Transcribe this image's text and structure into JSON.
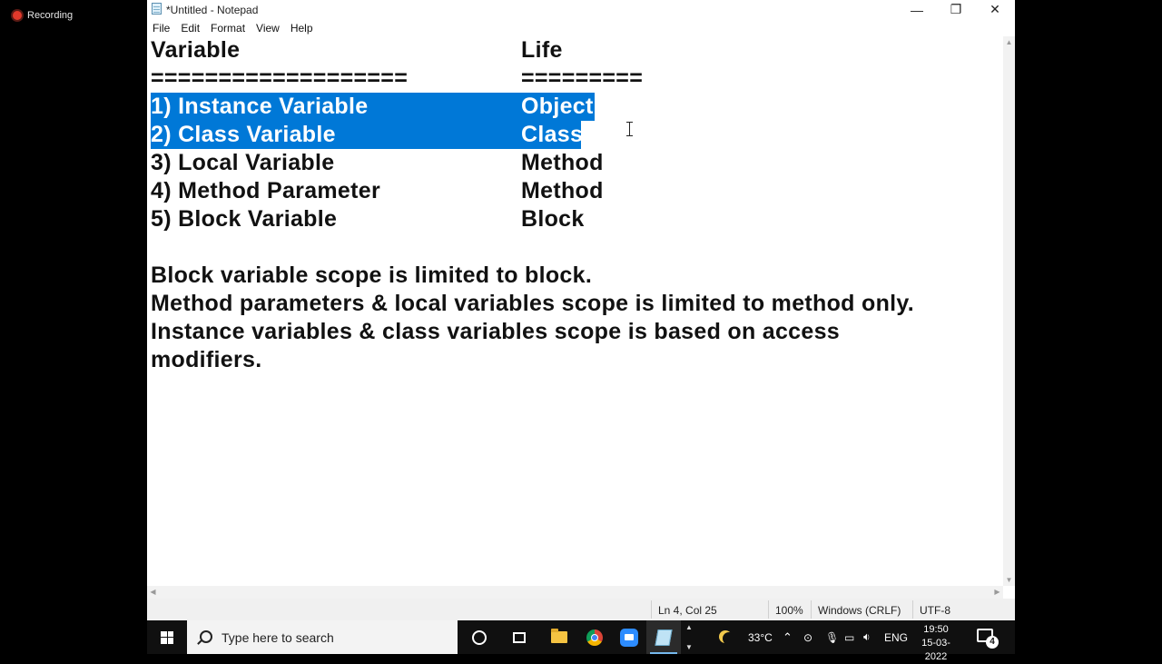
{
  "recording": {
    "label": "Recording"
  },
  "window": {
    "title": "*Untitled - Notepad",
    "minimize_glyph": "—",
    "maximize_glyph": "❐",
    "close_glyph": "✕"
  },
  "menu": [
    "File",
    "Edit",
    "Format",
    "View",
    "Help"
  ],
  "editor": {
    "header": {
      "col1": "Variable",
      "col2": "Life"
    },
    "underline": {
      "col1": "===================",
      "col2": "========="
    },
    "rows": [
      {
        "col1": "1) Instance Variable",
        "col2": "Object",
        "selected": true
      },
      {
        "col1": "2) Class Variable",
        "col2": "Class",
        "selected": true
      },
      {
        "col1": "3) Local Variable",
        "col2": "Method",
        "selected": false
      },
      {
        "col1": "4) Method Parameter",
        "col2": "Method",
        "selected": false
      },
      {
        "col1": "5) Block Variable",
        "col2": "Block",
        "selected": false
      }
    ],
    "notes": [
      "Block variable scope is limited to block.",
      "Method parameters & local variables scope is limited to method only.",
      "Instance variables & class variables scope is based on access",
      "modifiers."
    ],
    "selection_color": "#0078d7"
  },
  "statusbar": {
    "position": "Ln 4, Col 25",
    "zoom": "100%",
    "line_ending": "Windows (CRLF)",
    "encoding": "UTF-8"
  },
  "taskbar": {
    "search_placeholder": "Type here to search",
    "apps": [
      "cortana-icon",
      "task-view-icon",
      "file-explorer-icon",
      "chrome-icon",
      "zoom-icon",
      "notepad-icon"
    ],
    "weather": "33°C",
    "language": "ENG",
    "time": "19:50",
    "date": "15-03-2022",
    "notification_count": "4"
  }
}
